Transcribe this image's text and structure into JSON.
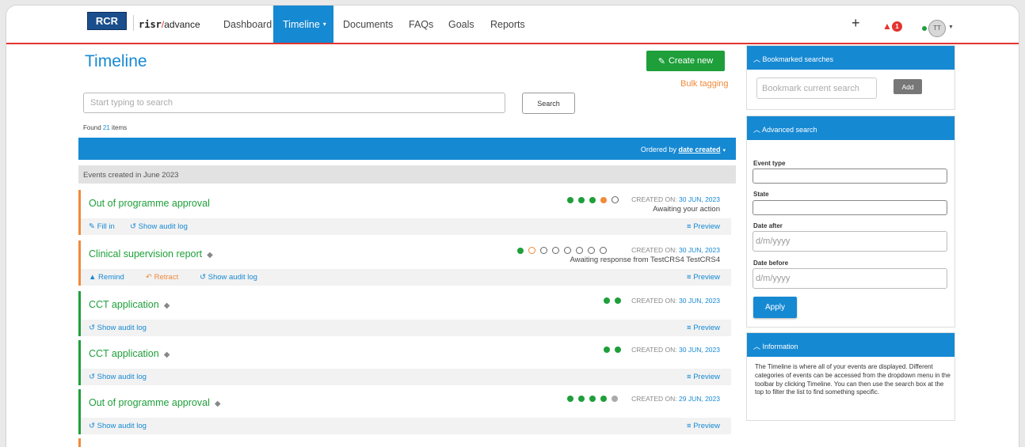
{
  "nav": {
    "logo": "RCR",
    "logo_sub": "The Royal College of Radiologists",
    "brand_risr": "risr",
    "brand_slash": "/",
    "brand_advance": "advance",
    "items": [
      "Dashboard",
      "Timeline",
      "Documents",
      "FAQs",
      "Goals",
      "Reports"
    ],
    "active": "Timeline",
    "plus": "+",
    "notifications": "1",
    "avatar": "TT"
  },
  "main": {
    "title": "Timeline",
    "create_label": "Create new",
    "bulk_label": "Bulk tagging",
    "search_placeholder": "Start typing to search",
    "search_button": "Search",
    "found_prefix": "Found ",
    "found_count": "21",
    "found_suffix": " items",
    "ordered_prefix": "Ordered by ",
    "ordered_link": "date created",
    "group": "Events created in June 2023"
  },
  "events": [
    {
      "title": "Out of programme approval",
      "created_label": "CREATED ON:",
      "created_date": "30 JUN, 2023",
      "status": "Awaiting your action",
      "actions": [
        "Fill in",
        "Show audit log"
      ],
      "preview": "Preview"
    },
    {
      "title": "Clinical supervision report",
      "created_label": "CREATED ON:",
      "created_date": "30 JUN, 2023",
      "status": "Awaiting response from TestCRS4 TestCRS4",
      "actions": [
        "Remind",
        "Retract",
        "Show audit log"
      ],
      "preview": "Preview"
    },
    {
      "title": "CCT application",
      "created_label": "CREATED ON:",
      "created_date": "30 JUN, 2023",
      "actions": [
        "Show audit log"
      ],
      "preview": "Preview"
    },
    {
      "title": "CCT application",
      "created_label": "CREATED ON:",
      "created_date": "30 JUN, 2023",
      "actions": [
        "Show audit log"
      ],
      "preview": "Preview"
    },
    {
      "title": "Out of programme approval",
      "created_label": "CREATED ON:",
      "created_date": "29 JUN, 2023",
      "actions": [
        "Show audit log"
      ],
      "preview": "Preview"
    }
  ],
  "sidebar": {
    "bookmarked": {
      "header": "Bookmarked searches",
      "placeholder": "Bookmark current search",
      "add": "Add"
    },
    "advanced": {
      "header": "Advanced search",
      "event_type": "Event type",
      "state": "State",
      "date_after": "Date after",
      "date_before": "Date before",
      "date_placeholder": "d/m/yyyy",
      "apply": "Apply"
    },
    "info": {
      "header": "Information",
      "text": "The Timeline is where all of your events are displayed. Different categories of events can be accessed from the dropdown menu in the toolbar by clicking Timeline. You can then use the search box at the top to filter the list to find something specific."
    }
  },
  "colors": {
    "primary": "#1689d3",
    "success": "#1e9f3a",
    "warning": "#f08a3c",
    "danger": "#e3342f"
  }
}
